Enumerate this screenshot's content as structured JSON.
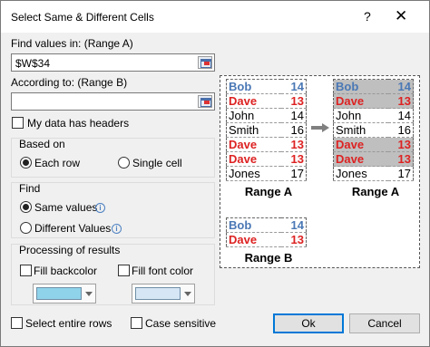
{
  "window": {
    "title": "Select Same & Different Cells",
    "help_label": "?",
    "close_label": "✕"
  },
  "range_a": {
    "label": "Find values in: (Range A)",
    "value": "$W$34"
  },
  "range_b": {
    "label": "According to: (Range B)",
    "value": ""
  },
  "headers_check": {
    "label": "My data has headers",
    "checked": false
  },
  "based_on": {
    "title": "Based on",
    "options": [
      "Each row",
      "Single cell"
    ],
    "selected": "Each row"
  },
  "find": {
    "title": "Find",
    "options": [
      "Same values",
      "Different Values"
    ],
    "selected": "Same values"
  },
  "processing": {
    "title": "Processing of results",
    "backcolor_label": "Fill backcolor",
    "fontcolor_label": "Fill font color",
    "backcolor": "#8fd3ea",
    "fontcolor": "#d6e6f4"
  },
  "footer": {
    "select_rows_label": "Select entire rows",
    "case_label": "Case sensitive",
    "ok_label": "Ok",
    "cancel_label": "Cancel"
  },
  "preview": {
    "range_a_caption": "Range A",
    "range_b_caption": "Range B",
    "range_a_rows": [
      {
        "name": "Bob",
        "num": "14",
        "style": "blue"
      },
      {
        "name": "Dave",
        "num": "13",
        "style": "red"
      },
      {
        "name": "John",
        "num": "14",
        "style": ""
      },
      {
        "name": "Smith",
        "num": "16",
        "style": ""
      },
      {
        "name": "Dave",
        "num": "13",
        "style": "red"
      },
      {
        "name": "Dave",
        "num": "13",
        "style": "red"
      },
      {
        "name": "Jones",
        "num": "17",
        "style": ""
      }
    ],
    "result_rows": [
      {
        "name": "Bob",
        "num": "14",
        "style": "blue",
        "hl": true
      },
      {
        "name": "Dave",
        "num": "13",
        "style": "red",
        "hl": true
      },
      {
        "name": "John",
        "num": "14",
        "style": "",
        "hl": false
      },
      {
        "name": "Smith",
        "num": "16",
        "style": "",
        "hl": false
      },
      {
        "name": "Dave",
        "num": "13",
        "style": "red",
        "hl": true
      },
      {
        "name": "Dave",
        "num": "13",
        "style": "red",
        "hl": true
      },
      {
        "name": "Jones",
        "num": "17",
        "style": "",
        "hl": false
      }
    ],
    "range_b_rows": [
      {
        "name": "Bob",
        "num": "14",
        "style": "blue"
      },
      {
        "name": "Dave",
        "num": "13",
        "style": "red"
      }
    ]
  }
}
